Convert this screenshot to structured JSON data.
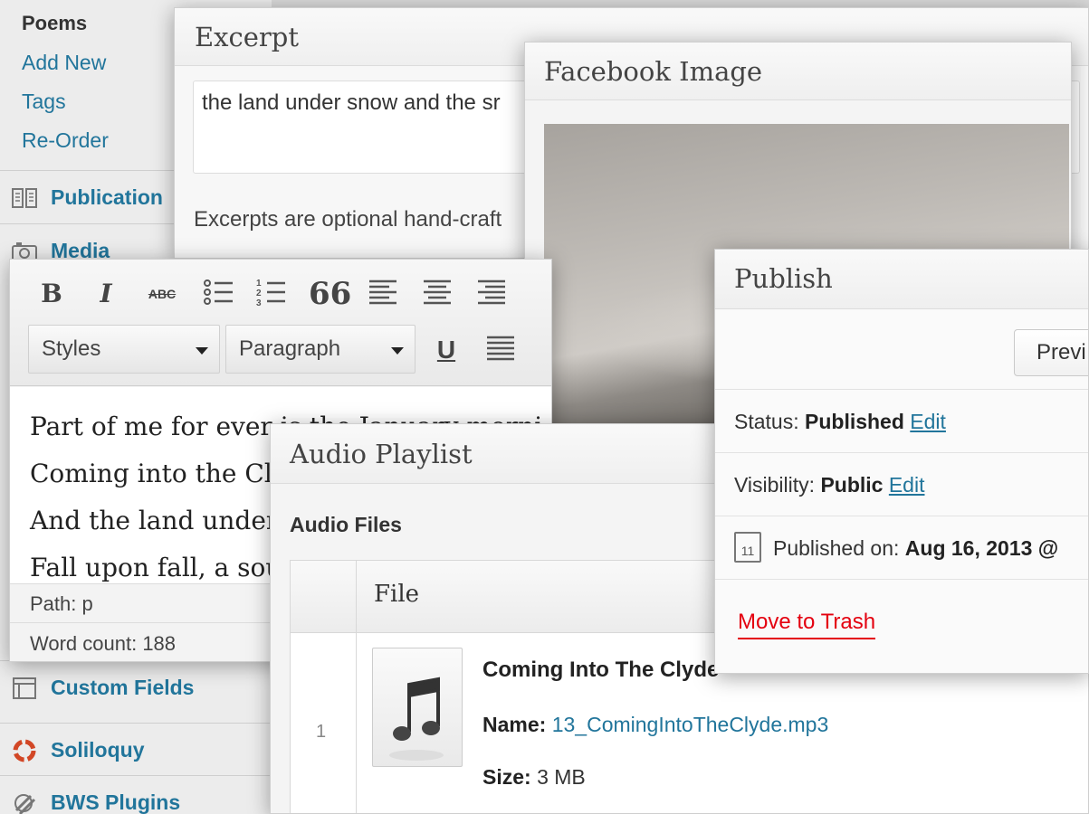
{
  "sidebar": {
    "section_title": "Poems",
    "sub_items": [
      "Add New",
      "Tags",
      "Re-Order"
    ],
    "menu": [
      {
        "label": "Publication",
        "icon": "book-icon"
      },
      {
        "label": "Media",
        "icon": "camera-icon"
      },
      {
        "label": "Custom Fields",
        "icon": "form-icon"
      },
      {
        "label": "Soliloquy",
        "icon": "ring-icon"
      },
      {
        "label": "BWS Plugins",
        "icon": "plugin-icon"
      }
    ]
  },
  "excerpt": {
    "title": "Excerpt",
    "value": "the land under snow and the sr",
    "help": "Excerpts are optional hand-craft"
  },
  "facebook": {
    "title": "Facebook Image"
  },
  "editor": {
    "toolbar": {
      "bold": "B",
      "italic": "I",
      "strike": "ABC",
      "quote": "66",
      "underline": "U",
      "styles_select": "Styles",
      "format_select": "Paragraph"
    },
    "lines": [
      "Part of me for ever is the January morni",
      "Coming into the Cl",
      "And the land under",
      "Fall upon fall, a sou"
    ],
    "path": "Path: p",
    "word_count": "Word count: 188"
  },
  "audio": {
    "title": "Audio Playlist",
    "subtitle": "Audio Files",
    "column_file": "File",
    "row_number": "1",
    "track_title": "Coming Into The Clyde",
    "name_label": "Name:",
    "name_value": "13_ComingIntoTheClyde.mp3",
    "size_label": "Size:",
    "size_value": "3 MB"
  },
  "publish": {
    "title": "Publish",
    "preview_button": "Previ",
    "status_label": "Status:",
    "status_value": "Published",
    "visibility_label": "Visibility:",
    "visibility_value": "Public",
    "edit_link": "Edit",
    "calendar_day": "11",
    "published_label": "Published on:",
    "published_value": "Aug 16, 2013 @",
    "trash": "Move to Trash"
  },
  "colors": {
    "link": "#21759b",
    "trash": "#e4000f"
  }
}
